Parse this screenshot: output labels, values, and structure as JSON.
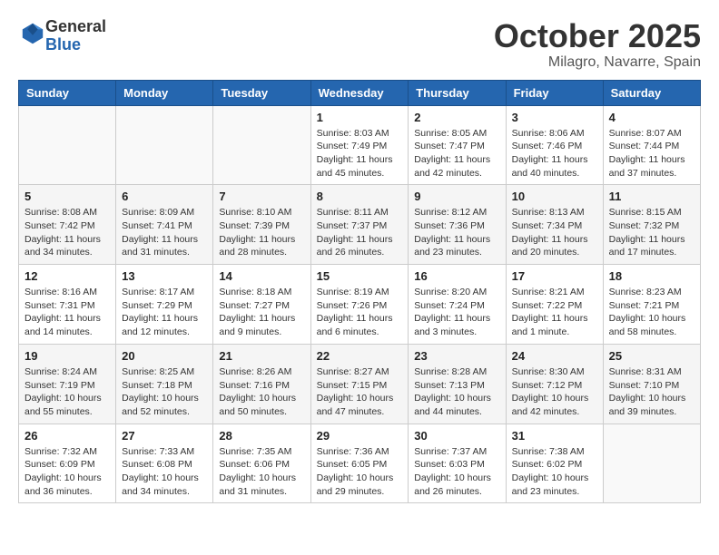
{
  "header": {
    "logo_general": "General",
    "logo_blue": "Blue",
    "month": "October 2025",
    "location": "Milagro, Navarre, Spain"
  },
  "weekdays": [
    "Sunday",
    "Monday",
    "Tuesday",
    "Wednesday",
    "Thursday",
    "Friday",
    "Saturday"
  ],
  "weeks": [
    [
      {
        "day": "",
        "info": ""
      },
      {
        "day": "",
        "info": ""
      },
      {
        "day": "",
        "info": ""
      },
      {
        "day": "1",
        "info": "Sunrise: 8:03 AM\nSunset: 7:49 PM\nDaylight: 11 hours\nand 45 minutes."
      },
      {
        "day": "2",
        "info": "Sunrise: 8:05 AM\nSunset: 7:47 PM\nDaylight: 11 hours\nand 42 minutes."
      },
      {
        "day": "3",
        "info": "Sunrise: 8:06 AM\nSunset: 7:46 PM\nDaylight: 11 hours\nand 40 minutes."
      },
      {
        "day": "4",
        "info": "Sunrise: 8:07 AM\nSunset: 7:44 PM\nDaylight: 11 hours\nand 37 minutes."
      }
    ],
    [
      {
        "day": "5",
        "info": "Sunrise: 8:08 AM\nSunset: 7:42 PM\nDaylight: 11 hours\nand 34 minutes."
      },
      {
        "day": "6",
        "info": "Sunrise: 8:09 AM\nSunset: 7:41 PM\nDaylight: 11 hours\nand 31 minutes."
      },
      {
        "day": "7",
        "info": "Sunrise: 8:10 AM\nSunset: 7:39 PM\nDaylight: 11 hours\nand 28 minutes."
      },
      {
        "day": "8",
        "info": "Sunrise: 8:11 AM\nSunset: 7:37 PM\nDaylight: 11 hours\nand 26 minutes."
      },
      {
        "day": "9",
        "info": "Sunrise: 8:12 AM\nSunset: 7:36 PM\nDaylight: 11 hours\nand 23 minutes."
      },
      {
        "day": "10",
        "info": "Sunrise: 8:13 AM\nSunset: 7:34 PM\nDaylight: 11 hours\nand 20 minutes."
      },
      {
        "day": "11",
        "info": "Sunrise: 8:15 AM\nSunset: 7:32 PM\nDaylight: 11 hours\nand 17 minutes."
      }
    ],
    [
      {
        "day": "12",
        "info": "Sunrise: 8:16 AM\nSunset: 7:31 PM\nDaylight: 11 hours\nand 14 minutes."
      },
      {
        "day": "13",
        "info": "Sunrise: 8:17 AM\nSunset: 7:29 PM\nDaylight: 11 hours\nand 12 minutes."
      },
      {
        "day": "14",
        "info": "Sunrise: 8:18 AM\nSunset: 7:27 PM\nDaylight: 11 hours\nand 9 minutes."
      },
      {
        "day": "15",
        "info": "Sunrise: 8:19 AM\nSunset: 7:26 PM\nDaylight: 11 hours\nand 6 minutes."
      },
      {
        "day": "16",
        "info": "Sunrise: 8:20 AM\nSunset: 7:24 PM\nDaylight: 11 hours\nand 3 minutes."
      },
      {
        "day": "17",
        "info": "Sunrise: 8:21 AM\nSunset: 7:22 PM\nDaylight: 11 hours\nand 1 minute."
      },
      {
        "day": "18",
        "info": "Sunrise: 8:23 AM\nSunset: 7:21 PM\nDaylight: 10 hours\nand 58 minutes."
      }
    ],
    [
      {
        "day": "19",
        "info": "Sunrise: 8:24 AM\nSunset: 7:19 PM\nDaylight: 10 hours\nand 55 minutes."
      },
      {
        "day": "20",
        "info": "Sunrise: 8:25 AM\nSunset: 7:18 PM\nDaylight: 10 hours\nand 52 minutes."
      },
      {
        "day": "21",
        "info": "Sunrise: 8:26 AM\nSunset: 7:16 PM\nDaylight: 10 hours\nand 50 minutes."
      },
      {
        "day": "22",
        "info": "Sunrise: 8:27 AM\nSunset: 7:15 PM\nDaylight: 10 hours\nand 47 minutes."
      },
      {
        "day": "23",
        "info": "Sunrise: 8:28 AM\nSunset: 7:13 PM\nDaylight: 10 hours\nand 44 minutes."
      },
      {
        "day": "24",
        "info": "Sunrise: 8:30 AM\nSunset: 7:12 PM\nDaylight: 10 hours\nand 42 minutes."
      },
      {
        "day": "25",
        "info": "Sunrise: 8:31 AM\nSunset: 7:10 PM\nDaylight: 10 hours\nand 39 minutes."
      }
    ],
    [
      {
        "day": "26",
        "info": "Sunrise: 7:32 AM\nSunset: 6:09 PM\nDaylight: 10 hours\nand 36 minutes."
      },
      {
        "day": "27",
        "info": "Sunrise: 7:33 AM\nSunset: 6:08 PM\nDaylight: 10 hours\nand 34 minutes."
      },
      {
        "day": "28",
        "info": "Sunrise: 7:35 AM\nSunset: 6:06 PM\nDaylight: 10 hours\nand 31 minutes."
      },
      {
        "day": "29",
        "info": "Sunrise: 7:36 AM\nSunset: 6:05 PM\nDaylight: 10 hours\nand 29 minutes."
      },
      {
        "day": "30",
        "info": "Sunrise: 7:37 AM\nSunset: 6:03 PM\nDaylight: 10 hours\nand 26 minutes."
      },
      {
        "day": "31",
        "info": "Sunrise: 7:38 AM\nSunset: 6:02 PM\nDaylight: 10 hours\nand 23 minutes."
      },
      {
        "day": "",
        "info": ""
      }
    ]
  ]
}
